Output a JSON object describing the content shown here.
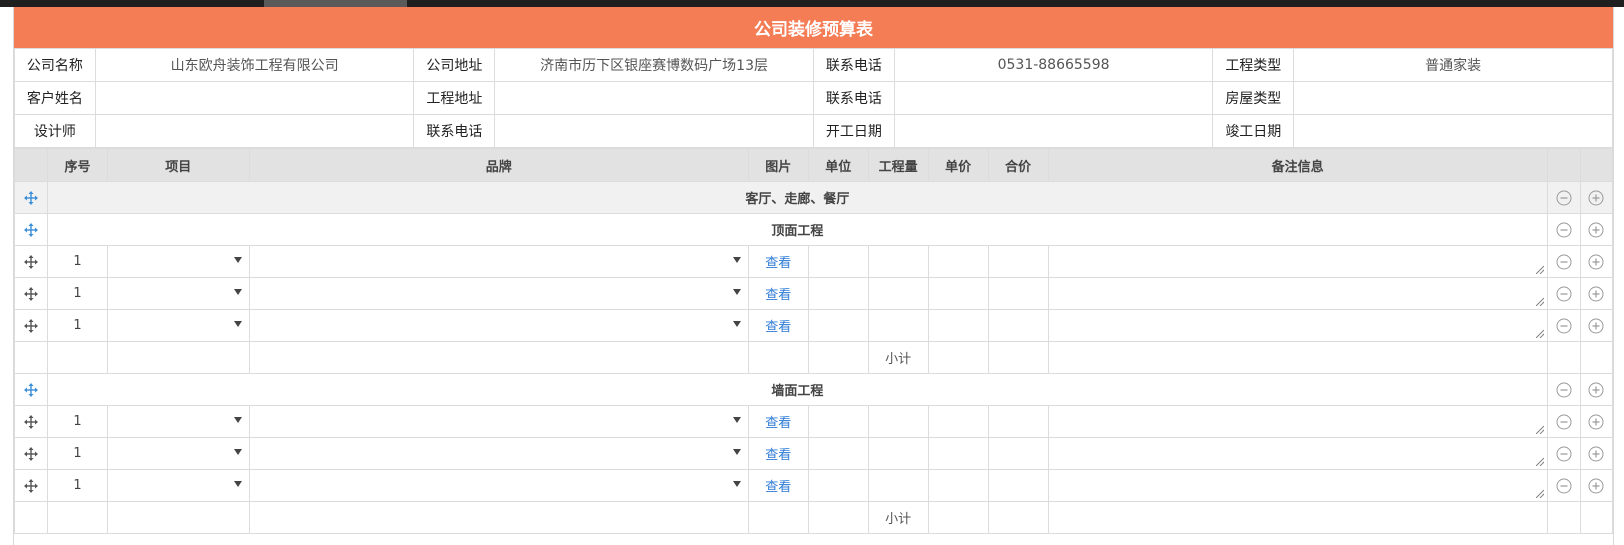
{
  "title": "公司装修预算表",
  "info_rows": [
    [
      {
        "label": "公司名称",
        "value": "山东欧舟装饰工程有限公司"
      },
      {
        "label": "公司地址",
        "value": "济南市历下区银座赛博数码广场13层"
      },
      {
        "label": "联系电话",
        "value": "0531-88665598"
      },
      {
        "label": "工程类型",
        "value": "普通家装"
      }
    ],
    [
      {
        "label": "客户姓名",
        "value": ""
      },
      {
        "label": "工程地址",
        "value": ""
      },
      {
        "label": "联系电话",
        "value": ""
      },
      {
        "label": "房屋类型",
        "value": ""
      }
    ],
    [
      {
        "label": "设计师",
        "value": ""
      },
      {
        "label": "联系电话",
        "value": ""
      },
      {
        "label": "开工日期",
        "value": ""
      },
      {
        "label": "竣工日期",
        "value": ""
      }
    ]
  ],
  "columns": {
    "seq": "序号",
    "item": "项目",
    "brand": "品牌",
    "image": "图片",
    "unit": "单位",
    "quantity": "工程量",
    "unit_price": "单价",
    "total": "合价",
    "note": "备注信息"
  },
  "category": "客厅、走廊、餐厅",
  "sections": [
    {
      "name": "顶面工程",
      "rows": [
        {
          "seq": "1",
          "view": "查看"
        },
        {
          "seq": "1",
          "view": "查看"
        },
        {
          "seq": "1",
          "view": "查看"
        }
      ],
      "subtotal": "小计"
    },
    {
      "name": "墙面工程",
      "rows": [
        {
          "seq": "1",
          "view": "查看"
        },
        {
          "seq": "1",
          "view": "查看"
        },
        {
          "seq": "1",
          "view": "查看"
        }
      ],
      "subtotal": "小计"
    }
  ],
  "colors": {
    "header": "#f47d56",
    "link": "#2e7bd6",
    "move_icon_category": "#3a8fd8",
    "move_icon_row": "#555555"
  }
}
